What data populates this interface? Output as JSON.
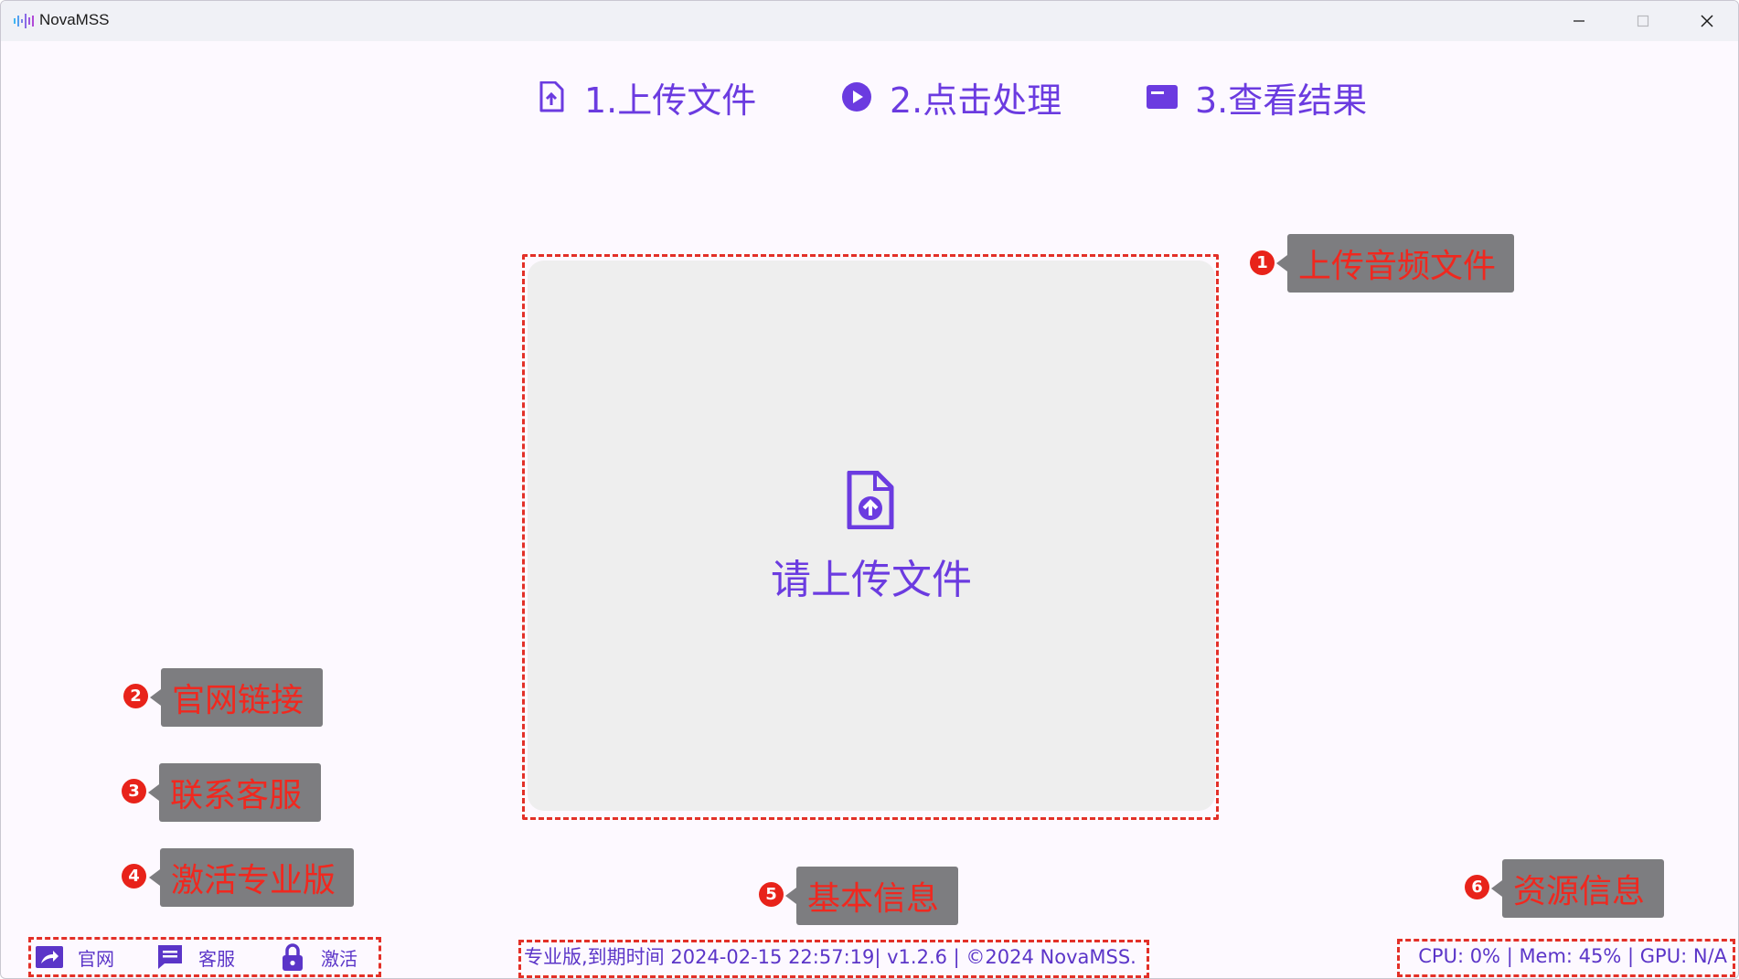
{
  "window": {
    "title": "NovaMSS"
  },
  "header": {
    "logo_icon": "waveform-logo",
    "steps": [
      {
        "label": "1.上传文件",
        "icon": "file-upload-icon"
      },
      {
        "label": "2.点击处理",
        "icon": "play-circle-icon"
      },
      {
        "label": "3.查看结果",
        "icon": "result-card-icon"
      }
    ]
  },
  "upload": {
    "icon": "file-upload-icon",
    "prompt": "请上传文件"
  },
  "annotations": [
    {
      "number": "1",
      "label": "上传音频文件"
    },
    {
      "number": "2",
      "label": "官网链接"
    },
    {
      "number": "3",
      "label": "联系客服"
    },
    {
      "number": "4",
      "label": "激活专业版"
    },
    {
      "number": "5",
      "label": "基本信息"
    },
    {
      "number": "6",
      "label": "资源信息"
    }
  ],
  "footer": {
    "links": [
      {
        "label": "官网",
        "icon": "share-arrow-icon"
      },
      {
        "label": "客服",
        "icon": "chat-icon"
      },
      {
        "label": "激活",
        "icon": "lock-icon"
      }
    ],
    "info": "专业版,到期时间 2024-02-15 22:57:19| v1.2.6 | ©2024 NovaMSS.",
    "resources": "CPU: 0% | Mem: 45% | GPU: N/A"
  },
  "colors": {
    "accent": "#6b3be0",
    "annotation_red": "#e33028",
    "tag_bg": "#7d7d80",
    "upload_bg": "#eeeeee",
    "window_bg": "#fdf9ff"
  }
}
